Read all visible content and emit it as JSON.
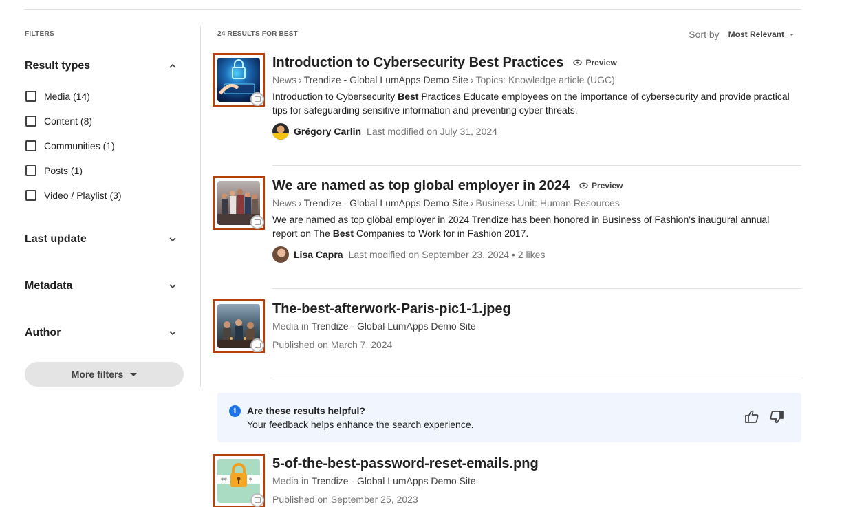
{
  "filters": {
    "title": "FILTERS",
    "result_types": {
      "label": "Result types",
      "options": [
        {
          "label": "Media (14)"
        },
        {
          "label": "Content (8)"
        },
        {
          "label": "Communities (1)"
        },
        {
          "label": "Posts (1)"
        },
        {
          "label": "Video / Playlist (3)"
        }
      ]
    },
    "last_update": "Last update",
    "metadata": "Metadata",
    "author": "Author",
    "more_filters": "More filters"
  },
  "results_header": {
    "count": "24 RESULTS FOR BEST",
    "sort_label": "Sort by",
    "sort_value": "Most Relevant"
  },
  "results": [
    {
      "title": "Introduction to Cybersecurity Best Practices",
      "preview": "Preview",
      "crumb_type": "News",
      "crumb_site": "Trendize - Global LumApps Demo Site",
      "crumb_extra": "Topics: Knowledge article (UGC)",
      "excerpt_before": "Introduction to Cybersecurity ",
      "excerpt_bold": "Best",
      "excerpt_after": " Practices Educate employees on the importance of cybersecurity and provide practical tips for safeguarding sensitive information and preventing cyber threats.",
      "author": "Grégory Carlin",
      "modified": "Last modified on July 31, 2024"
    },
    {
      "title": "We are named as top global employer in 2024",
      "preview": "Preview",
      "crumb_type": "News",
      "crumb_site": "Trendize - Global LumApps Demo Site",
      "crumb_extra": "Business Unit: Human Resources",
      "excerpt_before": "We are named as top global employer in 2024 Trendize has been honored in Business of Fashion's inaugural annual report on The ",
      "excerpt_bold": "Best",
      "excerpt_after": " Companies to Work for in Fashion 2017.",
      "author": "Lisa Capra",
      "modified": "Last modified on September 23, 2024 • 2 likes"
    },
    {
      "title": "The-best-afterwork-Paris-pic1-1.jpeg",
      "media_prefix": "Media in",
      "site": "Trendize - Global LumApps Demo Site",
      "published": "Published on March 7, 2024"
    },
    {
      "title": "5-of-the-best-password-reset-emails.png",
      "media_prefix": "Media in",
      "site": "Trendize - Global LumApps Demo Site",
      "published": "Published on September 25, 2023"
    }
  ],
  "feedback": {
    "info_glyph": "i",
    "title": "Are these results helpful?",
    "subtitle": "Your feedback helps enhance the search experience."
  },
  "colors": {
    "highlight_border": "#b5400b",
    "info_blue": "#1a73e8",
    "feedback_bg": "#f1f5fd"
  }
}
